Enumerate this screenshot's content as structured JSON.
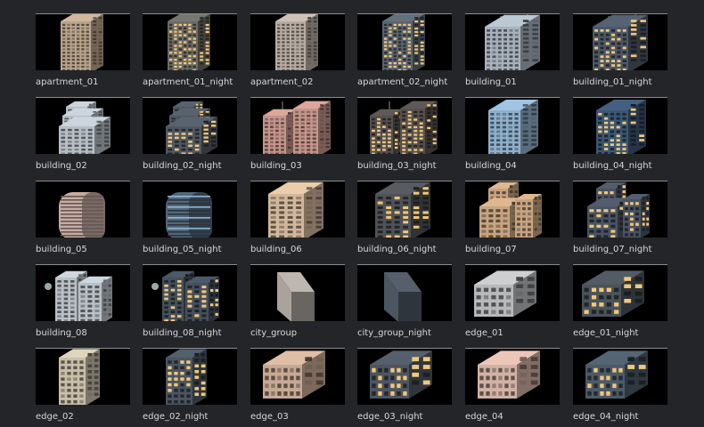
{
  "window": {
    "title": ""
  },
  "assets": [
    {
      "label": "apartment_01",
      "kind": "tower-classic",
      "tint": "#b9a48c",
      "lit": false
    },
    {
      "label": "apartment_01_night",
      "kind": "tower-classic",
      "tint": "#6b6a63",
      "lit": true
    },
    {
      "label": "apartment_02",
      "kind": "tower-tall",
      "tint": "#b8ada3",
      "lit": false
    },
    {
      "label": "apartment_02_night",
      "kind": "tower-tall",
      "tint": "#5a6470",
      "lit": true
    },
    {
      "label": "building_01",
      "kind": "block-antenna",
      "tint": "#a8b2bd",
      "lit": false
    },
    {
      "label": "building_01_night",
      "kind": "block-antenna",
      "tint": "#4d5866",
      "lit": true
    },
    {
      "label": "building_02",
      "kind": "stepped",
      "tint": "#b6bec6",
      "lit": false
    },
    {
      "label": "building_02_night",
      "kind": "stepped",
      "tint": "#4f5862",
      "lit": true
    },
    {
      "label": "building_03",
      "kind": "twin",
      "tint": "#c4958a",
      "lit": false
    },
    {
      "label": "building_03_night",
      "kind": "twin",
      "tint": "#55504e",
      "lit": true
    },
    {
      "label": "building_04",
      "kind": "glass",
      "tint": "#8fb0cc",
      "lit": false
    },
    {
      "label": "building_04_night",
      "kind": "glass",
      "tint": "#3d5672",
      "lit": true
    },
    {
      "label": "building_05",
      "kind": "round",
      "tint": "#c7aca3",
      "lit": false
    },
    {
      "label": "building_05_night",
      "kind": "round",
      "tint": "#53677a",
      "lit": true
    },
    {
      "label": "building_06",
      "kind": "block-wide",
      "tint": "#d2b79b",
      "lit": false
    },
    {
      "label": "building_06_night",
      "kind": "block-wide",
      "tint": "#4f5256",
      "lit": true
    },
    {
      "label": "building_07",
      "kind": "cluster",
      "tint": "#c7a480",
      "lit": false
    },
    {
      "label": "building_07_night",
      "kind": "cluster",
      "tint": "#4a5361",
      "lit": true
    },
    {
      "label": "building_08",
      "kind": "mixed",
      "tint": "#b9c0c6",
      "lit": false
    },
    {
      "label": "building_08_night",
      "kind": "mixed",
      "tint": "#45505c",
      "lit": true
    },
    {
      "label": "city_group",
      "kind": "slab",
      "tint": "#a9a39c",
      "lit": false
    },
    {
      "label": "city_group_night",
      "kind": "slab",
      "tint": "#4c5660",
      "lit": true
    },
    {
      "label": "edge_01",
      "kind": "low-block",
      "tint": "#b7b9bb",
      "lit": false
    },
    {
      "label": "edge_01_night",
      "kind": "low-block",
      "tint": "#4a525a",
      "lit": true
    },
    {
      "label": "edge_02",
      "kind": "mid-block",
      "tint": "#c9bfa9",
      "lit": false
    },
    {
      "label": "edge_02_night",
      "kind": "mid-block",
      "tint": "#4a5561",
      "lit": true
    },
    {
      "label": "edge_03",
      "kind": "wide-low",
      "tint": "#c8a993",
      "lit": false
    },
    {
      "label": "edge_03_night",
      "kind": "wide-low",
      "tint": "#4d5560",
      "lit": true
    },
    {
      "label": "edge_04",
      "kind": "wide-low",
      "tint": "#d3b2a5",
      "lit": false
    },
    {
      "label": "edge_04_night",
      "kind": "wide-low",
      "tint": "#4c5a68",
      "lit": true
    }
  ],
  "colors": {
    "background": "#232528",
    "thumb_bg": "#000000",
    "label": "#d8d8d8",
    "window_lit": "#f2c77a"
  }
}
